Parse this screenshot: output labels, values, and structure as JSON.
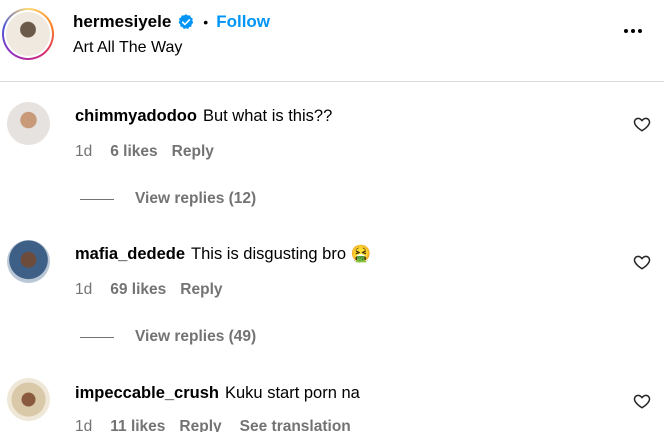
{
  "post_header": {
    "username": "hermesiyele",
    "separator": "•",
    "follow_label": "Follow",
    "subtitle": "Art All The Way"
  },
  "comments": [
    {
      "username": "chimmyadodoo",
      "text": "But what is this??",
      "time": "1d",
      "likes": "6 likes",
      "reply_label": "Reply",
      "view_replies": "View replies (12)"
    },
    {
      "username": "mafia_dedede",
      "text": "This is disgusting bro 🤮",
      "time": "1d",
      "likes": "69 likes",
      "reply_label": "Reply",
      "view_replies": "View replies (49)"
    },
    {
      "username": "impeccable_crush",
      "text": "Kuku start porn na",
      "time": "1d",
      "likes": "11 likes",
      "reply_label": "Reply",
      "translation_label": "See translation"
    }
  ],
  "colors": {
    "accent": "#0095f6",
    "muted": "#737373",
    "divider": "#dbdbdb",
    "verified": "#0095f6"
  },
  "icons": {
    "verified": "verified-badge-icon",
    "more": "more-options-icon",
    "like": "heart-icon"
  }
}
